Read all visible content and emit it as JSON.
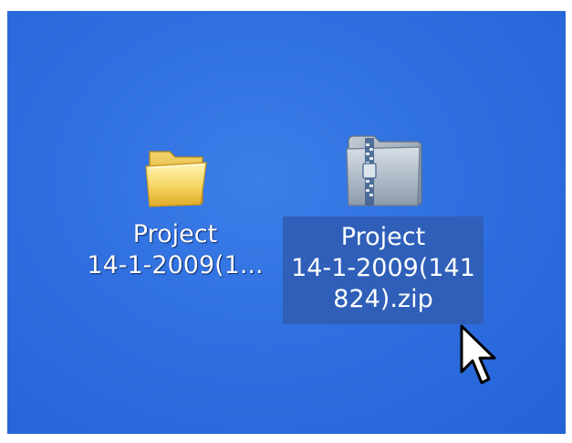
{
  "desktop": {
    "icons": [
      {
        "type": "folder",
        "label_line1": "Project",
        "label_line2": "14-1-2009(1...",
        "label_line3": "",
        "selected": false
      },
      {
        "type": "zip",
        "label_line1": "Project",
        "label_line2": "14-1-2009(141",
        "label_line3": "824).zip",
        "selected": true
      }
    ]
  },
  "colors": {
    "desktop_blue": "#2f6fe0",
    "selection_blue": "#2f5fb8",
    "label_text": "#ffffff",
    "folder_yellow": "#f5cf5a",
    "zip_gray": "#8f9fb0"
  },
  "cursor": {
    "icon": "arrow-pointer-icon"
  }
}
